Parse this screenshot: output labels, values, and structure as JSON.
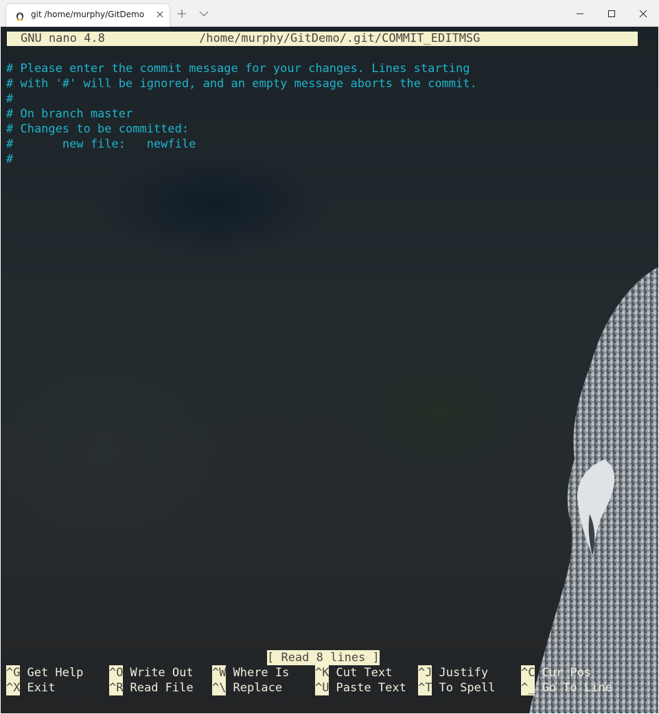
{
  "tab": {
    "title": "git /home/murphy/GitDemo",
    "icon": "linux-penguin-icon"
  },
  "window_controls": {
    "new_tab_icon": "plus-icon",
    "dropdown_icon": "chevron-down-icon",
    "minimize_icon": "minimize-icon",
    "maximize_icon": "maximize-icon",
    "close_icon": "close-icon"
  },
  "nano": {
    "version": "GNU nano 4.8",
    "filepath": "/home/murphy/GitDemo/.git/COMMIT_EDITMSG",
    "lines": [
      "# Please enter the commit message for your changes. Lines starting",
      "# with '#' will be ignored, and an empty message aborts the commit.",
      "#",
      "# On branch master",
      "# Changes to be committed:",
      "#       new file:   newfile",
      "#"
    ],
    "status": "[ Read 8 lines ]",
    "shortcuts": [
      {
        "key": "^G",
        "label": "Get Help"
      },
      {
        "key": "^O",
        "label": "Write Out"
      },
      {
        "key": "^W",
        "label": "Where Is"
      },
      {
        "key": "^K",
        "label": "Cut Text"
      },
      {
        "key": "^J",
        "label": "Justify"
      },
      {
        "key": "^C",
        "label": "Cur Pos"
      },
      {
        "key": "^X",
        "label": "Exit"
      },
      {
        "key": "^R",
        "label": "Read File"
      },
      {
        "key": "^\\",
        "label": "Replace"
      },
      {
        "key": "^U",
        "label": "Paste Text"
      },
      {
        "key": "^T",
        "label": "To Spell"
      },
      {
        "key": "^_",
        "label": "Go To Line"
      }
    ]
  },
  "colors": {
    "header_bg": "#f4f1cd",
    "comment_text": "#1fb4cc",
    "shortcut_label": "#f0eede"
  }
}
